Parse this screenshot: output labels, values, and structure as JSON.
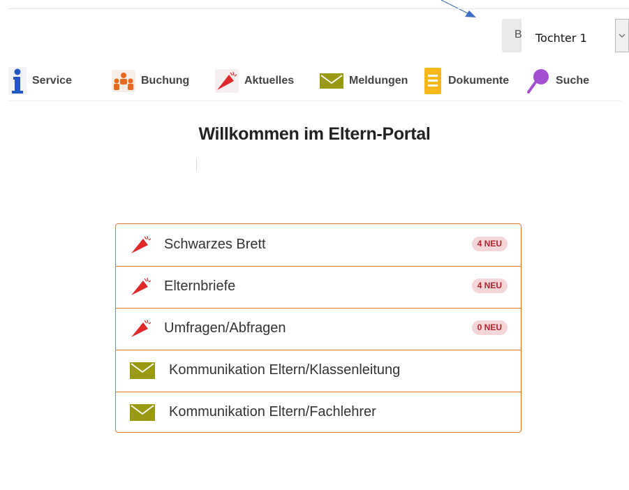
{
  "child_select": {
    "prefix": "B",
    "value": "Tochter 1"
  },
  "nav": {
    "items": [
      {
        "label": "Service",
        "icon": "info-icon"
      },
      {
        "label": "Buchung",
        "icon": "people-icon"
      },
      {
        "label": "Aktuelles",
        "icon": "megaphone-icon"
      },
      {
        "label": "Meldungen",
        "icon": "envelope-icon"
      },
      {
        "label": "Dokumente",
        "icon": "document-icon"
      },
      {
        "label": "Suche",
        "icon": "search-icon"
      }
    ]
  },
  "main": {
    "title": "Willkommen im Eltern-Portal",
    "rows": [
      {
        "label": "Schwarzes Brett",
        "icon": "megaphone-icon",
        "badge": "4 NEU"
      },
      {
        "label": "Elternbriefe",
        "icon": "megaphone-icon",
        "badge": "4 NEU"
      },
      {
        "label": "Umfragen/Abfragen",
        "icon": "megaphone-icon",
        "badge": "0 NEU"
      },
      {
        "label": "Kommunikation Eltern/Klassenleitung",
        "icon": "envelope-icon"
      },
      {
        "label": "Kommunikation Eltern/Fachlehrer",
        "icon": "envelope-icon"
      }
    ]
  },
  "colors": {
    "accent": "#e0762e",
    "megaphone": "#e02828",
    "envelope": "#9a9a10",
    "info": "#2457c5",
    "badge_bg": "#f5d6d8",
    "badge_text": "#b0232f"
  }
}
